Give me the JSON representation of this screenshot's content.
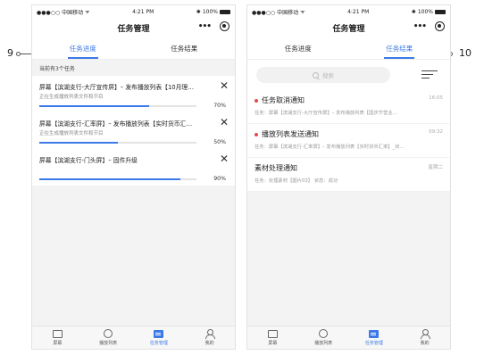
{
  "status_bar": {
    "carrier": "●●●○○ 中国移动",
    "wifi": "ᯤ",
    "time": "4:21 PM",
    "bluetooth": "✱",
    "battery": "100%"
  },
  "nav": {
    "title": "任务管理",
    "more": "•••"
  },
  "tabs": [
    "任务进度",
    "任务结果"
  ],
  "left": {
    "count_label": "当前有3个任务",
    "tasks": [
      {
        "title": "屏幕【滨湖支行-大厅宣传屏】– 发布播放列表【10月理…",
        "subtitle": "正在生成播放列表文件和节目",
        "progress": 0.7,
        "percent": "70%"
      },
      {
        "title": "屏幕【滨湖支行-汇率屏】– 发布播放列表【实时货币汇…",
        "subtitle": "正在生成播放列表文件和节目",
        "progress": 0.5,
        "percent": "50%"
      },
      {
        "title": "屏幕【滨湖支行-门头屏】– 固件升级",
        "subtitle": "",
        "progress": 0.9,
        "percent": "90%"
      }
    ]
  },
  "right": {
    "search_placeholder": "搜索",
    "results": [
      {
        "title": "任务取消通知",
        "subtitle": "任务：屏幕【滨湖支行-大厅宣传屏】– 发布播放列表【国庆节营业…",
        "time": "16:05",
        "unread": true
      },
      {
        "title": "播放列表发送通知",
        "subtitle": "任务：屏幕【滨湖支行-汇率屏】– 发布播放列表【实时货币汇率】_状…",
        "time": "09:32",
        "unread": true
      },
      {
        "title": "素材处理通知",
        "subtitle": "任务：处理素材【图片03】 状态：成功",
        "time": "星期二",
        "unread": false
      }
    ]
  },
  "bottom_nav": [
    {
      "label": "屏幕",
      "icon": "screen-icon"
    },
    {
      "label": "播放列表",
      "icon": "playlist-icon"
    },
    {
      "label": "任务管理",
      "icon": "task-icon"
    },
    {
      "label": "我的",
      "icon": "user-icon"
    }
  ],
  "callouts": {
    "left": "9",
    "right": "10"
  },
  "colors": {
    "accent": "#3c7ae8",
    "unread_dot": "#e54b4b"
  }
}
